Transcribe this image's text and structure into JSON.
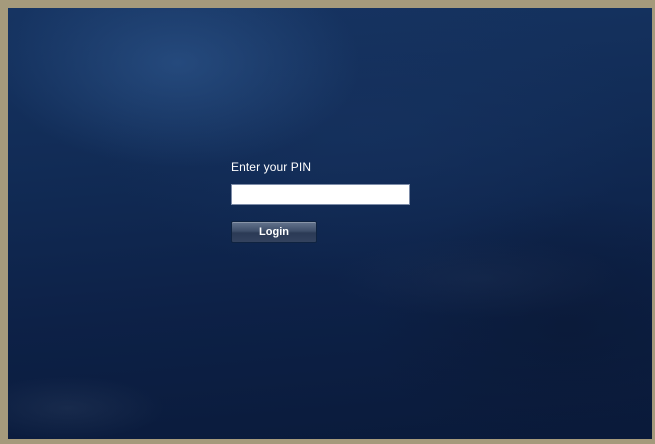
{
  "login": {
    "pin_label": "Enter your PIN",
    "pin_value": "",
    "login_button_label": "Login"
  },
  "colors": {
    "frame_border": "#a59a7c",
    "background_deep_blue": "#0d2147",
    "button": "#3f4f6a"
  }
}
